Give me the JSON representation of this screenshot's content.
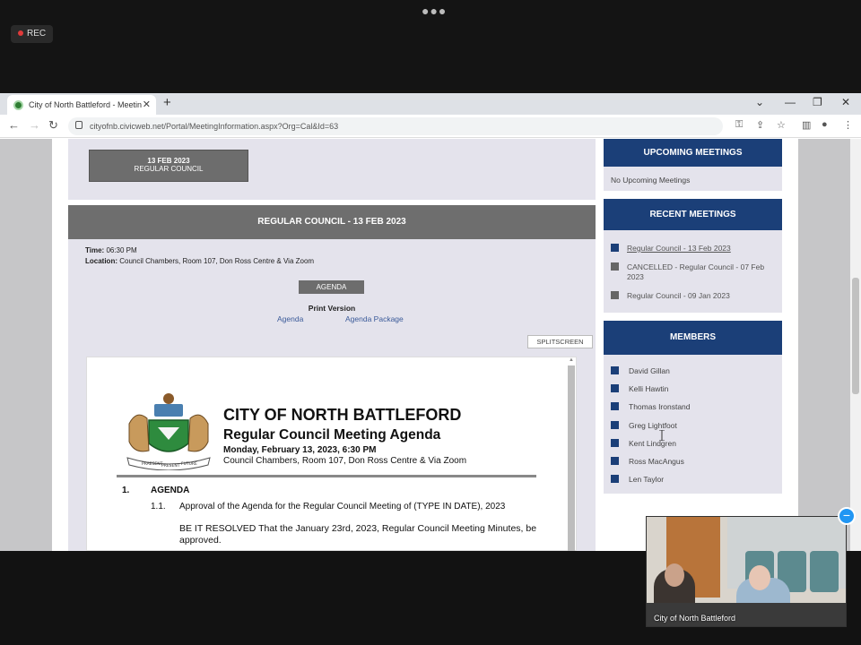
{
  "recording": {
    "label": "REC"
  },
  "browser": {
    "tab_title": "City of North Battleford - Meetin",
    "url": "cityofnb.civicweb.net/Portal/MeetingInformation.aspx?Org=Cal&Id=63"
  },
  "meeting": {
    "date_button": {
      "line1": "13 FEB 2023",
      "line2": "REGULAR COUNCIL"
    },
    "header": "REGULAR COUNCIL - 13 FEB 2023",
    "time_label": "Time:",
    "time": "06:30 PM",
    "location_label": "Location:",
    "location": "Council Chambers, Room 107, Don Ross Centre & Via Zoom",
    "agenda_button": "AGENDA",
    "print_version_label": "Print Version",
    "print_links": [
      "Agenda",
      "Agenda Package"
    ],
    "splitscreen_button": "SPLITSCREEN"
  },
  "pdf": {
    "title": "CITY OF NORTH BATTLEFORD",
    "subtitle": "Regular Council Meeting Agenda",
    "date": "Monday, February 13, 2023, 6:30 PM",
    "location": "Council Chambers, Room 107, Don Ross Centre & Via Zoom",
    "crest_motto": [
      "PRAESENT",
      "PRESENT",
      "FUTURE"
    ],
    "section_number": "1.",
    "section_label": "AGENDA",
    "item_number": "1.1.",
    "item_text": "Approval of the Agenda for the Regular Council Meeting of (TYPE IN DATE), 2023",
    "resolution": "BE IT RESOLVED That the January 23rd, 2023, Regular Council Meeting Minutes, be approved."
  },
  "sidebar": {
    "upcoming": {
      "title": "UPCOMING MEETINGS",
      "empty_text": "No Upcoming Meetings"
    },
    "recent": {
      "title": "RECENT MEETINGS",
      "items": [
        {
          "label": "Regular Council - 13 Feb 2023",
          "color": "#1b3f78"
        },
        {
          "label": "CANCELLED - Regular Council - 07 Feb 2023",
          "color": "#666666"
        },
        {
          "label": "Regular Council - 09 Jan 2023",
          "color": "#666666"
        }
      ]
    },
    "members": {
      "title": "MEMBERS",
      "items": [
        "David Gillan",
        "Kelli Hawtin",
        "Thomas Ironstand",
        "Greg Lightfoot",
        "Kent Lindgren",
        "Ross MacAngus",
        "Len Taylor"
      ]
    }
  },
  "video": {
    "participant_label": "City of North Battleford"
  },
  "colors": {
    "accent": "#1b3f78",
    "panel": "#e4e3ec",
    "header_gray": "#6e6e6e"
  }
}
